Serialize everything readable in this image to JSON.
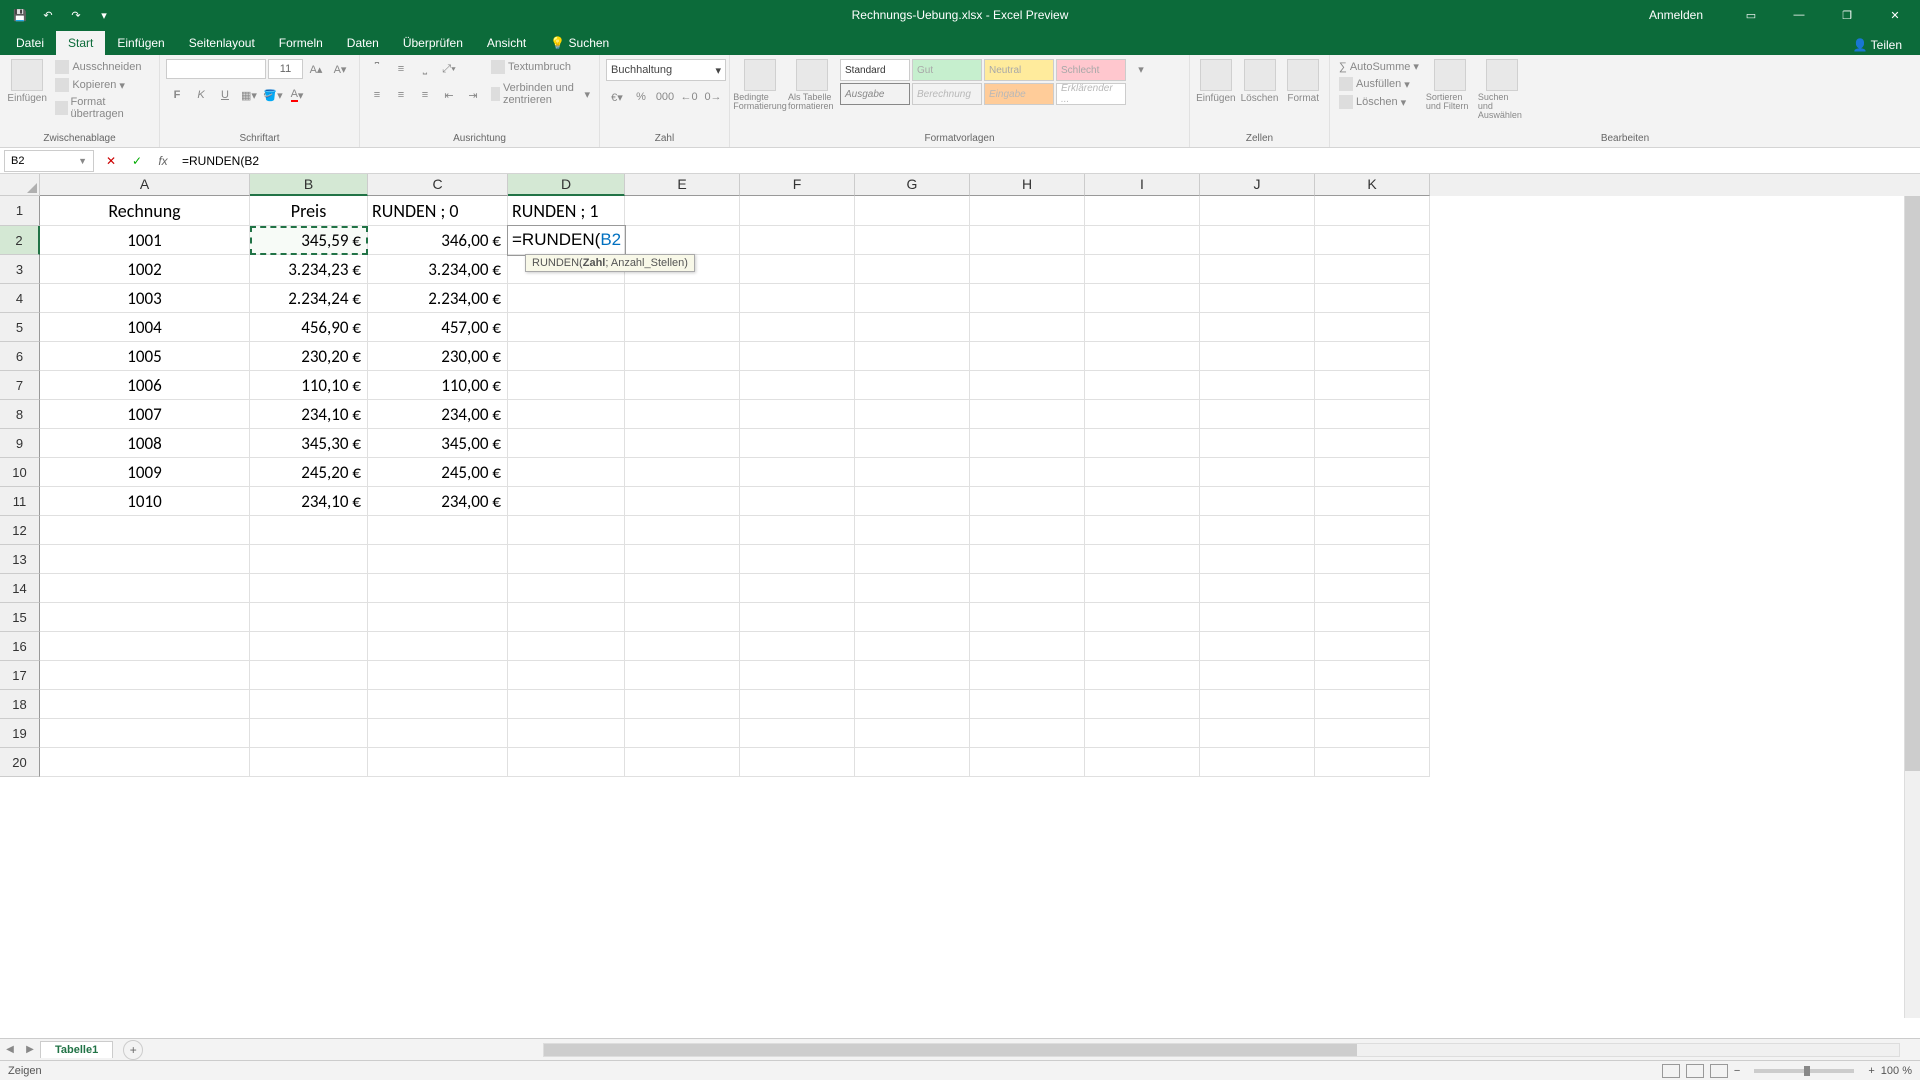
{
  "app": {
    "title": "Rechnungs-Uebung.xlsx - Excel Preview",
    "anmelden": "Anmelden"
  },
  "tabs": {
    "datei": "Datei",
    "start": "Start",
    "einfuegen": "Einfügen",
    "seitenlayout": "Seitenlayout",
    "formeln": "Formeln",
    "daten": "Daten",
    "ueberpruefen": "Überprüfen",
    "ansicht": "Ansicht",
    "suchen": "Suchen",
    "teilen": "Teilen"
  },
  "ribbon": {
    "zwischenablage": {
      "label": "Zwischenablage",
      "einfuegen": "Einfügen",
      "ausschneiden": "Ausschneiden",
      "kopieren": "Kopieren",
      "format_uebertragen": "Format übertragen"
    },
    "schriftart": {
      "label": "Schriftart",
      "font_name": "",
      "font_size": "11"
    },
    "ausrichtung": {
      "label": "Ausrichtung",
      "textumbruch": "Textumbruch",
      "verbinden": "Verbinden und zentrieren"
    },
    "zahl": {
      "label": "Zahl",
      "format": "Buchhaltung"
    },
    "formatvorlagen": {
      "label": "Formatvorlagen",
      "bedingte": "Bedingte Formatierung",
      "als_tabelle": "Als Tabelle formatieren",
      "standard": "Standard",
      "gut": "Gut",
      "neutral": "Neutral",
      "schlecht": "Schlecht",
      "ausgabe": "Ausgabe",
      "berechnung": "Berechnung",
      "eingabe": "Eingabe",
      "erklaerender": "Erklärender ..."
    },
    "zellen": {
      "label": "Zellen",
      "einfuegen": "Einfügen",
      "loeschen": "Löschen",
      "format": "Format"
    },
    "bearbeiten": {
      "label": "Bearbeiten",
      "autosumme": "AutoSumme",
      "ausfuellen": "Ausfüllen",
      "loeschen": "Löschen",
      "sortieren": "Sortieren und Filtern",
      "suchen": "Suchen und Auswählen"
    }
  },
  "namebox": "B2",
  "formula": "=RUNDEN(B2",
  "columns": [
    "A",
    "B",
    "C",
    "D",
    "E",
    "F",
    "G",
    "H",
    "I",
    "J",
    "K"
  ],
  "headers": {
    "A": "Rechnung",
    "B": "Preis",
    "C": "RUNDEN ; 0",
    "D": "RUNDEN ; 1"
  },
  "editing_cell": {
    "prefix": "=RUNDEN(",
    "ref": "B2"
  },
  "tooltip": "RUNDEN(Zahl; Anzahl_Stellen)",
  "rows": [
    {
      "A": "1001",
      "B": "345,59 €",
      "C": "346,00 €"
    },
    {
      "A": "1002",
      "B": "3.234,23 €",
      "C": "3.234,00 €"
    },
    {
      "A": "1003",
      "B": "2.234,24 €",
      "C": "2.234,00 €"
    },
    {
      "A": "1004",
      "B": "456,90 €",
      "C": "457,00 €"
    },
    {
      "A": "1005",
      "B": "230,20 €",
      "C": "230,00 €"
    },
    {
      "A": "1006",
      "B": "110,10 €",
      "C": "110,00 €"
    },
    {
      "A": "1007",
      "B": "234,10 €",
      "C": "234,00 €"
    },
    {
      "A": "1008",
      "B": "345,30 €",
      "C": "345,00 €"
    },
    {
      "A": "1009",
      "B": "245,20 €",
      "C": "245,00 €"
    },
    {
      "A": "1010",
      "B": "234,10 €",
      "C": "234,00 €"
    }
  ],
  "sheet": {
    "name": "Tabelle1"
  },
  "statusbar": {
    "mode": "Zeigen",
    "zoom": "100 %"
  }
}
